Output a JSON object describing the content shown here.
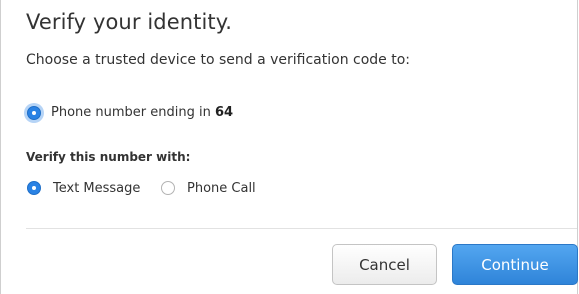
{
  "dialog": {
    "title": "Verify your identity.",
    "subtitle": "Choose a trusted device to send a verification code to:"
  },
  "device_option": {
    "label_prefix": "Phone number ending in",
    "label_suffix": "64",
    "selected": true
  },
  "verify_section": {
    "heading": "Verify this number with:",
    "options": [
      {
        "label": "Text Message",
        "selected": true
      },
      {
        "label": "Phone Call",
        "selected": false
      }
    ]
  },
  "buttons": {
    "cancel": "Cancel",
    "continue": "Continue"
  },
  "colors": {
    "accent": "#2a82e4",
    "primary_button": "#3b8fe0"
  }
}
